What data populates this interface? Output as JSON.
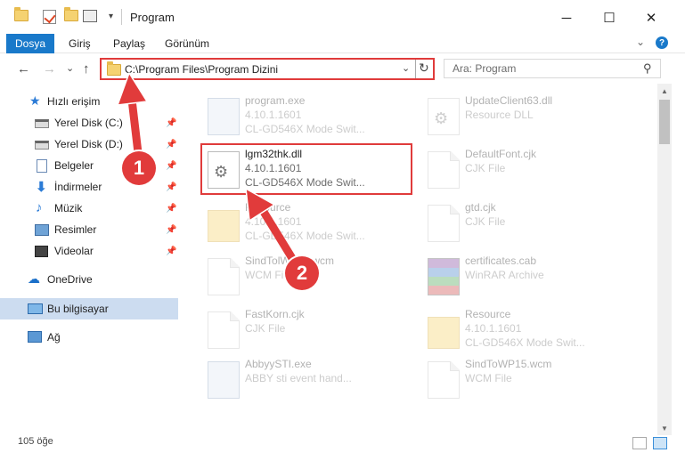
{
  "window": {
    "title": "Program",
    "minimize": "─",
    "maximize": "☐",
    "close": "✕"
  },
  "ribbon": {
    "tabs": [
      "Dosya",
      "Giriş",
      "Paylaş",
      "Görünüm"
    ],
    "help": "?"
  },
  "nav": {
    "back": "←",
    "forward": "→",
    "recent": "⌄",
    "up": "↑",
    "address": "C:\\Program Files\\Program Dizini",
    "address_dropdown": "⌄",
    "refresh": "↻",
    "search_placeholder": "Ara: Program",
    "search_icon": "⚲"
  },
  "sidebar": {
    "items": [
      {
        "label": "Hızlı erişim",
        "icon": "star-icon",
        "pinned": false
      },
      {
        "label": "Yerel Disk (C:)",
        "icon": "drive-icon",
        "pinned": true
      },
      {
        "label": "Yerel Disk (D:)",
        "icon": "drive-icon",
        "pinned": true
      },
      {
        "label": "Belgeler",
        "icon": "documents-icon",
        "pinned": true
      },
      {
        "label": "İndirmeler",
        "icon": "download-icon",
        "pinned": true
      },
      {
        "label": "Müzik",
        "icon": "music-icon",
        "pinned": true
      },
      {
        "label": "Resimler",
        "icon": "pictures-icon",
        "pinned": true
      },
      {
        "label": "Videolar",
        "icon": "videos-icon",
        "pinned": true
      },
      {
        "label": "OneDrive",
        "icon": "cloud-icon",
        "pinned": false
      },
      {
        "label": "Bu bilgisayar",
        "icon": "computer-icon",
        "pinned": false,
        "selected": true
      },
      {
        "label": "Ağ",
        "icon": "network-icon",
        "pinned": false
      }
    ]
  },
  "files": [
    {
      "name": "program.exe",
      "meta1": "4.10.1.1601",
      "meta2": "CL-GD546X Mode Swit...",
      "icon": "app-icon",
      "faded": true
    },
    {
      "name": "UpdateClient63.dll",
      "meta1": "Resource DLL",
      "meta2": "",
      "icon": "gear-file-icon",
      "faded": true
    },
    {
      "name": "lgm32thk.dll",
      "meta1": "4.10.1.1601",
      "meta2": "CL-GD546X Mode Swit...",
      "icon": "gear-file-icon",
      "faded": false
    },
    {
      "name": "DefaultFont.cjk",
      "meta1": "CJK File",
      "meta2": "",
      "icon": "file-icon",
      "faded": true
    },
    {
      "name": "Resource",
      "meta1": "4.10.1.1601",
      "meta2": "CL-GD546X Mode Swit...",
      "icon": "folder-icon",
      "faded": true
    },
    {
      "name": "gtd.cjk",
      "meta1": "CJK File",
      "meta2": "",
      "icon": "file-icon",
      "faded": true
    },
    {
      "name": "SindTolWP15.wcm",
      "meta1": "WCM File",
      "meta2": "",
      "icon": "file-icon",
      "faded": true
    },
    {
      "name": "certificates.cab",
      "meta1": "WinRAR Archive",
      "meta2": "",
      "icon": "archive-icon",
      "faded": true
    },
    {
      "name": "FastKorn.cjk",
      "meta1": "CJK File",
      "meta2": "",
      "icon": "file-icon",
      "faded": true
    },
    {
      "name": "Resource",
      "meta1": "4.10.1.1601",
      "meta2": "CL-GD546X Mode Swit...",
      "icon": "folder-icon",
      "faded": true
    },
    {
      "name": "AbbyySTI.exe",
      "meta1": "ABBY sti event hand...",
      "meta2": "",
      "icon": "app-icon",
      "faded": true
    },
    {
      "name": "SindToWP15.wcm",
      "meta1": "WCM File",
      "meta2": "",
      "icon": "file-icon",
      "faded": true
    }
  ],
  "annotations": {
    "step1": "1",
    "step2": "2",
    "color": "#e13b3b"
  },
  "status": {
    "count": "105 öğe"
  },
  "colors": {
    "accent": "#1979ca",
    "highlight": "#e03b3b",
    "selected_nav": "#ccdcf0"
  }
}
